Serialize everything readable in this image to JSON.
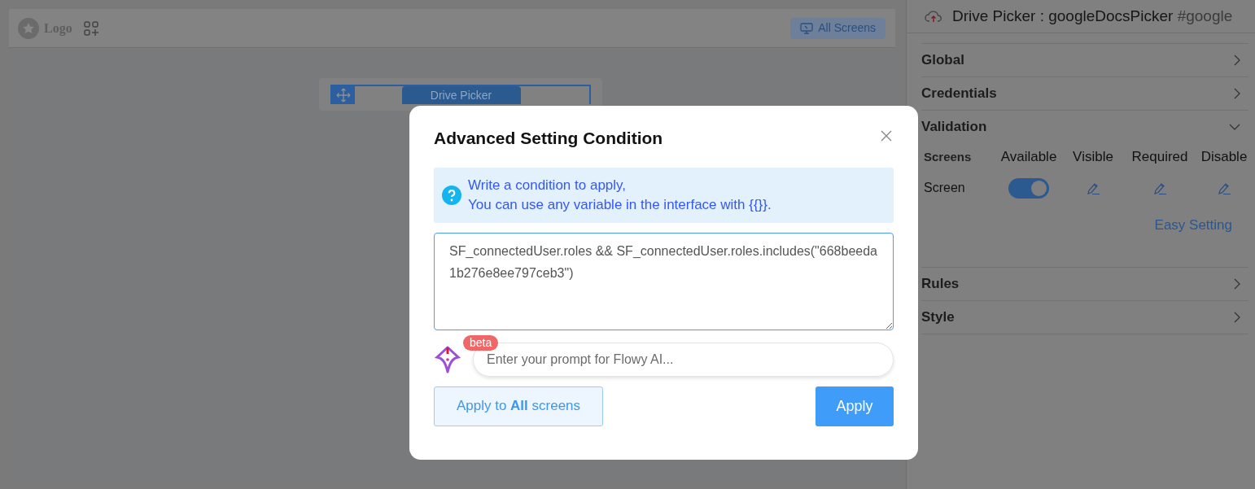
{
  "toolbar": {
    "logo": "Logo",
    "screens_button": "All Screens"
  },
  "canvas": {
    "component_label": "Drive Picker"
  },
  "properties": {
    "title": "Drive Picker : googleDocsPicker",
    "id": "#google",
    "sections": [
      {
        "title": "Global",
        "expanded": false
      },
      {
        "title": "Credentials",
        "expanded": false
      },
      {
        "title": "Validation",
        "expanded": true,
        "columns": [
          "Screens",
          "Available",
          "Visible",
          "Required",
          "Disable"
        ],
        "rows": [
          {
            "screen": "Screen",
            "available": true
          }
        ],
        "link": "Easy Setting"
      },
      {
        "title": "Rules",
        "expanded": false
      },
      {
        "title": "Style",
        "expanded": false
      }
    ]
  },
  "dialog": {
    "title": "Advanced Setting Condition",
    "info_lines": [
      "Write a condition to apply,",
      "You can use any variable in the interface with {{}}."
    ],
    "condition": "SF_connectedUser.roles && SF_connectedUser.roles.includes(\"668beeda1b276e8ee797ceb3\")",
    "badge": "beta",
    "prompt_placeholder": "Enter your prompt for Flowy AI...",
    "secondary_button": "Apply to **All** screens",
    "primary_button": "Apply"
  }
}
